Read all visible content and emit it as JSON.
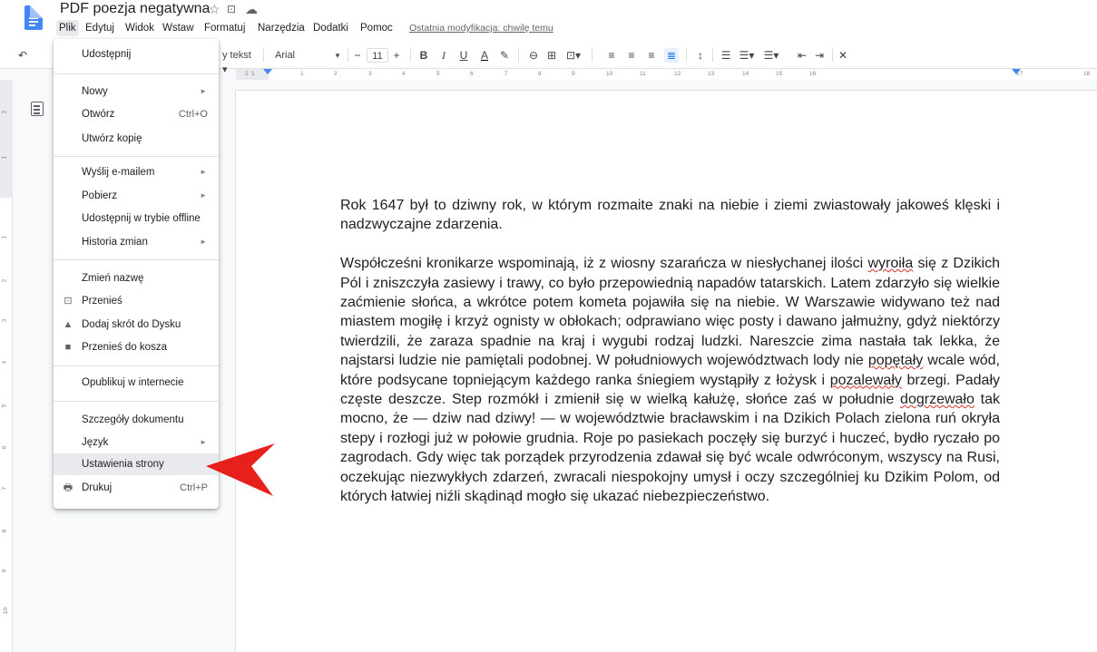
{
  "app": {
    "doc_title": "PDF poezja negatywna",
    "title_icons": [
      "star-icon",
      "folder-icon",
      "cloud-icon"
    ]
  },
  "menubar": {
    "items": [
      "Plik",
      "Edytuj",
      "Widok",
      "Wstaw",
      "Formatuj",
      "Narzędzia",
      "Dodatki",
      "Pomoc"
    ],
    "active": "Plik",
    "last_modified": "Ostatnia modyfikacja: chwilę temu"
  },
  "toolbar": {
    "style_label": "y tekst",
    "font_label": "Arial",
    "font_size": "11",
    "minus": "−",
    "plus": "+",
    "bold": "B",
    "italic": "I",
    "underline": "U",
    "text_color": "A"
  },
  "ruler": {
    "ticks": [
      "2",
      "1",
      "1",
      "2",
      "3",
      "4",
      "5",
      "6",
      "7",
      "8",
      "9",
      "10",
      "11",
      "12",
      "13",
      "14",
      "15",
      "16",
      "17",
      "18"
    ],
    "vticks": [
      "2",
      "1",
      "1",
      "2",
      "3",
      "4",
      "5",
      "6",
      "7",
      "8",
      "9",
      "10"
    ]
  },
  "file_menu": {
    "share": "Udostępnij",
    "new": "Nowy",
    "open": "Otwórz",
    "open_shortcut": "Ctrl+O",
    "copy": "Utwórz kopię",
    "email": "Wyślij e-mailem",
    "download": "Pobierz",
    "offline": "Udostępnij w trybie offline",
    "history": "Historia zmian",
    "rename": "Zmień nazwę",
    "move": "Przenieś",
    "shortcut_drive": "Dodaj skrót do Dysku",
    "trash": "Przenieś do kosza",
    "publish": "Opublikuj w internecie",
    "details": "Szczegóły dokumentu",
    "language": "Język",
    "page_setup": "Ustawienia strony",
    "print": "Drukuj",
    "print_shortcut": "Ctrl+P"
  },
  "document": {
    "p1": "Rok 1647 był to dziwny rok, w którym rozmaite znaki na niebie i ziemi zwiastowały jakoweś klęski i nadzwyczajne zdarzenia.",
    "p2_a": "Współcześni kronikarze wspominają, iż z wiosny szarańcza w niesłychanej ilości ",
    "p2_w1": "wyroiła",
    "p2_b": " się z Dzikich Pól i zniszczyła zasiewy i trawy, co było przepowiednią napadów tatarskich. Latem zdarzyło się wielkie zaćmienie słońca, a wkrótce potem kometa pojawiła się na niebie. W Warszawie widywano też nad miastem mogiłę i krzyż ognisty w obłokach; odprawiano więc posty i dawano jałmużny, gdyż niektórzy twierdzili, że zaraza spadnie na kraj i wygubi rodzaj ludzki. Nareszcie zima nastała tak lekka, że najstarsi ludzie nie pamiętali podobnej. W południowych województwach lody nie ",
    "p2_w2": "popętały",
    "p2_c": " wcale wód, które podsycane topniejącym każdego ranka śniegiem wystąpiły z łożysk i ",
    "p2_w3": "pozalewały",
    "p2_d": " brzegi. Padały częste deszcze. Step rozmókł i zmienił się w wielką kałużę, słońce zaś w południe ",
    "p2_w4": "dogrzewało",
    "p2_e": " tak mocno, że — dziw nad dziwy! — w województwie bracławskim i na Dzikich Polach zielona ruń okryła stepy i rozłogi już w połowie grudnia. Roje po pasiekach poczęły się burzyć i huczeć, bydło ryczało po zagrodach. Gdy więc tak porządek przyrodzenia zdawał się być wcale odwróconym, wszyscy na Rusi, oczekując niezwykłych zdarzeń, zwracali niespokojny umysł i oczy szczególniej ku Dzikim Polom, od których łatwiej niźli skądinąd mogło się ukazać niebezpieczeństwo."
  },
  "colors": {
    "accent": "#4285f4",
    "arrow": "#e8201c"
  }
}
